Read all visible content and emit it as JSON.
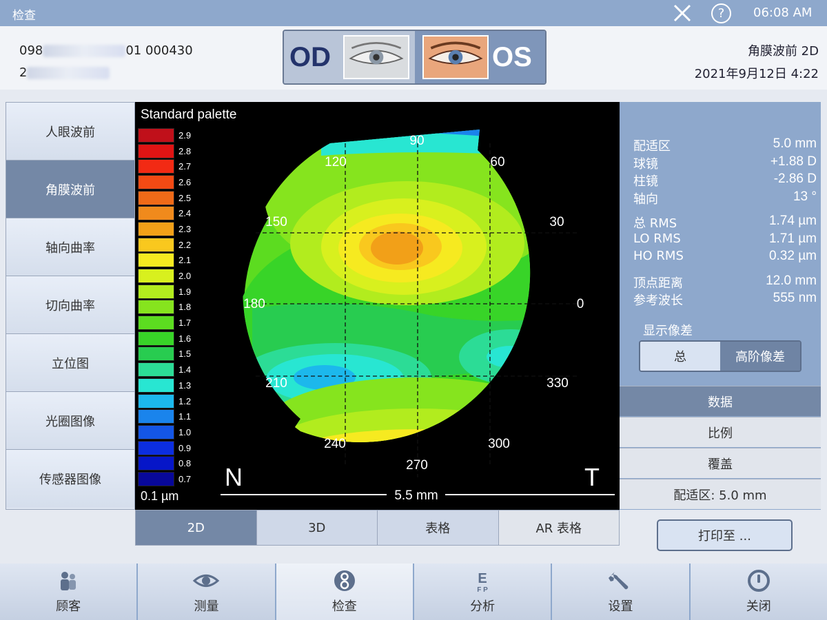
{
  "topbar": {
    "title": "检查",
    "help": "?",
    "time": "06:08 AM"
  },
  "patient": {
    "id_prefix": "098",
    "id_suffix": "01 000430",
    "line2": "2"
  },
  "eyes": {
    "od": "OD",
    "os": "OS"
  },
  "exam": {
    "type": "角膜波前 2D",
    "datetime": "2021年9月12日 4:22"
  },
  "sidebar": {
    "items": [
      {
        "label": "人眼波前"
      },
      {
        "label": "角膜波前"
      },
      {
        "label": "轴向曲率"
      },
      {
        "label": "切向曲率"
      },
      {
        "label": "立位图"
      },
      {
        "label": "光圈图像"
      },
      {
        "label": "传感器图像"
      }
    ]
  },
  "map": {
    "palette_title": "Standard palette",
    "unit": "0.1 µm",
    "scale_values": [
      "2.9",
      "2.8",
      "2.7",
      "2.6",
      "2.5",
      "2.4",
      "2.3",
      "2.2",
      "2.1",
      "2.0",
      "1.9",
      "1.8",
      "1.7",
      "1.6",
      "1.5",
      "1.4",
      "1.3",
      "1.2",
      "1.1",
      "1.0",
      "0.9",
      "0.8",
      "0.7"
    ],
    "scale_colors": [
      "#c0101a",
      "#e01414",
      "#f22a14",
      "#f34a14",
      "#f06a18",
      "#f08a1c",
      "#f2a018",
      "#f9c81e",
      "#f6ea20",
      "#d8f01e",
      "#b2ec1e",
      "#86e41e",
      "#5cdc20",
      "#38d428",
      "#28cc50",
      "#2cdc96",
      "#28e6d2",
      "#1cb8ec",
      "#1a84ec",
      "#1456e6",
      "#0c2ee0",
      "#0616c8",
      "#08089a"
    ],
    "angles": {
      "a90": "90",
      "a60": "60",
      "a30": "30",
      "a0": "0",
      "a330": "330",
      "a300": "300",
      "a270": "270",
      "a240": "240",
      "a210": "210",
      "a180": "180",
      "a150": "150",
      "a120": "120"
    },
    "nasal": "N",
    "temporal": "T",
    "diameter": "5.5 mm"
  },
  "view_tabs": [
    {
      "label": "2D"
    },
    {
      "label": "3D"
    },
    {
      "label": "表格"
    },
    {
      "label": "AR 表格"
    }
  ],
  "metrics": [
    {
      "label": "配适区",
      "value": "5.0 mm"
    },
    {
      "label": "球镜",
      "value": "+1.88 D"
    },
    {
      "label": "柱镜",
      "value": "-2.86 D"
    },
    {
      "label": "轴向",
      "value": "13 °"
    },
    {
      "label": "总 RMS",
      "value": "1.74 µm"
    },
    {
      "label": "LO RMS",
      "value": "1.71 µm"
    },
    {
      "label": "HO RMS",
      "value": "0.32 µm"
    },
    {
      "label": "顶点距离",
      "value": "12.0 mm"
    },
    {
      "label": "参考波长",
      "value": "555 nm"
    }
  ],
  "aberration": {
    "label": "显示像差",
    "total": "总",
    "higher_order": "高阶像差"
  },
  "right_buttons": {
    "data": "数据",
    "scale": "比例",
    "overlay": "覆盖",
    "zone": "配适区: 5.0 mm"
  },
  "print": {
    "label": "打印至 ..."
  },
  "bottom_nav": [
    {
      "label": "顾客",
      "icon": "customer-icon"
    },
    {
      "label": "测量",
      "icon": "eye-measure-icon"
    },
    {
      "label": "检查",
      "icon": "exam-icon"
    },
    {
      "label": "分析",
      "icon": "eye-chart-icon"
    },
    {
      "label": "设置",
      "icon": "wrench-icon"
    },
    {
      "label": "关闭",
      "icon": "power-icon"
    }
  ]
}
